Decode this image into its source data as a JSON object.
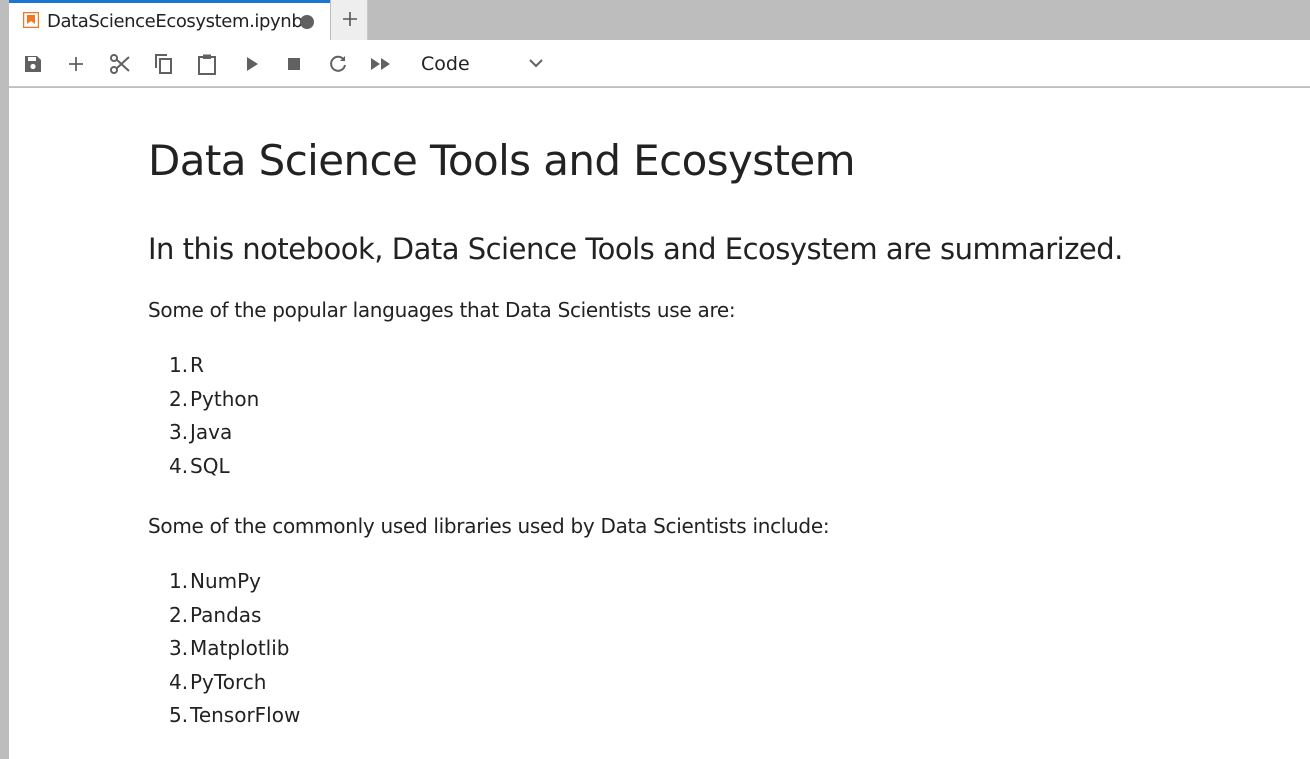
{
  "tab": {
    "title": "DataScienceEcosystem.ipynb",
    "dirty": true
  },
  "toolbar": {
    "buttons": [
      "save-icon",
      "add-cell-icon",
      "cut-icon",
      "copy-icon",
      "paste-icon",
      "run-icon",
      "stop-icon",
      "restart-icon",
      "run-all-icon"
    ],
    "cell_type": "Code"
  },
  "notebook": {
    "title": "Data Science Tools and Ecosystem",
    "intro": "In this notebook, Data Science Tools and Ecosystem are summarized.",
    "languages_heading": "Some of the popular languages that Data Scientists use are:",
    "languages": [
      {
        "num": "1.",
        "name": "R"
      },
      {
        "num": "2.",
        "name": "Python"
      },
      {
        "num": "3.",
        "name": "Java"
      },
      {
        "num": "4.",
        "name": "SQL"
      }
    ],
    "libraries_heading": "Some of the commonly used libraries used by Data Scientists include:",
    "libraries": [
      {
        "num": "1.",
        "name": "NumPy"
      },
      {
        "num": "2.",
        "name": "Pandas"
      },
      {
        "num": "3.",
        "name": "Matplotlib"
      },
      {
        "num": "4.",
        "name": "PyTorch"
      },
      {
        "num": "5.",
        "name": "TensorFlow"
      }
    ]
  },
  "colors": {
    "accent": "#1976d2",
    "notebook_icon": "#f37626",
    "icon": "#616161"
  }
}
